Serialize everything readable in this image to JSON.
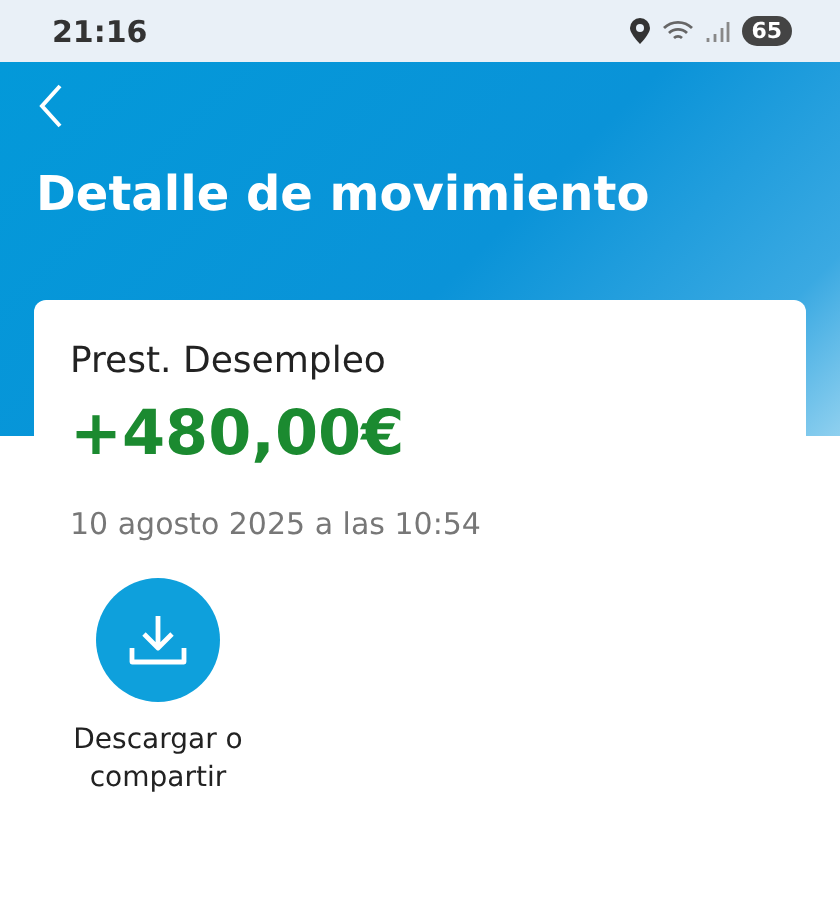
{
  "status_bar": {
    "time": "21:16",
    "battery": "65"
  },
  "header": {
    "title": "Detalle de movimiento"
  },
  "movement": {
    "concept": "Prest. Desempleo",
    "amount": "+480,00€",
    "date": "10 agosto 2025 a las 10:54"
  },
  "actions": [
    {
      "kind": "download",
      "label": "Descargar o compartir"
    }
  ]
}
